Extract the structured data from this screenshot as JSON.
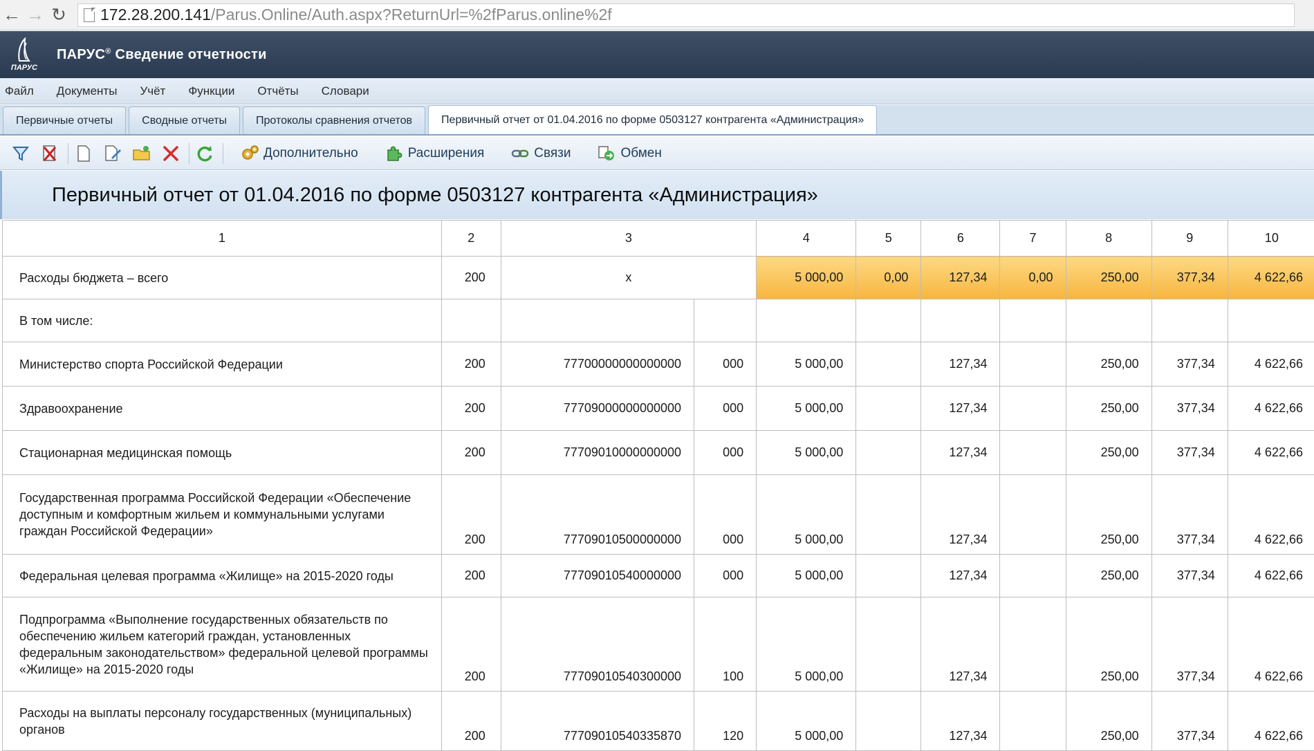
{
  "browser": {
    "url_host": "172.28.200.141",
    "url_path": "/Parus.Online/Auth.aspx?ReturnUrl=%2fParus.online%2f"
  },
  "app": {
    "logo_text": "ПАРУС",
    "title": "ПАРУС",
    "title_sup": "®",
    "title_rest": " Сведение отчетности"
  },
  "menu": [
    "Файл",
    "Документы",
    "Учёт",
    "Функции",
    "Отчёты",
    "Словари"
  ],
  "tabs": [
    {
      "label": "Первичные отчеты",
      "active": false
    },
    {
      "label": "Сводные отчеты",
      "active": false
    },
    {
      "label": "Протоколы сравнения отчетов",
      "active": false
    },
    {
      "label": "Первичный отчет от 01.04.2016 по форме 0503127 контрагента «Администрация»",
      "active": true
    }
  ],
  "toolbar": {
    "icons": [
      "filter-icon",
      "clear-filter-icon",
      "new-document-icon",
      "edit-document-icon",
      "open-folder-icon",
      "delete-icon",
      "refresh-icon"
    ],
    "buttons": [
      {
        "label": "Дополнительно",
        "icon": "gears-icon"
      },
      {
        "label": "Расширения",
        "icon": "puzzle-icon"
      },
      {
        "label": "Связи",
        "icon": "links-icon"
      },
      {
        "label": "Обмен",
        "icon": "exchange-icon"
      }
    ]
  },
  "report": {
    "caption": "Первичный отчет от 01.04.2016 по форме 0503127 контрагента «Администрация»",
    "columns": [
      "1",
      "2",
      "3",
      "4",
      "5",
      "6",
      "7",
      "8",
      "9",
      "10"
    ],
    "total_row": {
      "name": "Расходы бюджета – всего",
      "line": "200",
      "code": "x",
      "c4": "5 000,00",
      "c5": "0,00",
      "c6": "127,34",
      "c7": "0,00",
      "c8": "250,00",
      "c9": "377,34",
      "c10": "4 622,66"
    },
    "subheader": "В том числе:",
    "rows": [
      {
        "name": "Министерство спорта Российской Федерации",
        "line": "200",
        "code": "77700000000000000",
        "kvr": "000",
        "c4": "5 000,00",
        "c5": "",
        "c6": "127,34",
        "c7": "",
        "c8": "250,00",
        "c9": "377,34",
        "c10": "4 622,66"
      },
      {
        "name": "Здравоохранение",
        "line": "200",
        "code": "77709000000000000",
        "kvr": "000",
        "c4": "5 000,00",
        "c5": "",
        "c6": "127,34",
        "c7": "",
        "c8": "250,00",
        "c9": "377,34",
        "c10": "4 622,66"
      },
      {
        "name": "Стационарная медицинская помощь",
        "line": "200",
        "code": "77709010000000000",
        "kvr": "000",
        "c4": "5 000,00",
        "c5": "",
        "c6": "127,34",
        "c7": "",
        "c8": "250,00",
        "c9": "377,34",
        "c10": "4 622,66"
      },
      {
        "name": "Государственная программа Российской Федерации «Обеспечение доступным и комфортным жильем и коммунальными услугами граждан Российской Федерации»",
        "line": "200",
        "code": "77709010500000000",
        "kvr": "000",
        "c4": "5 000,00",
        "c5": "",
        "c6": "127,34",
        "c7": "",
        "c8": "250,00",
        "c9": "377,34",
        "c10": "4 622,66"
      },
      {
        "name": "Федеральная целевая программа «Жилище» на 2015-2020 годы",
        "line": "200",
        "code": "77709010540000000",
        "kvr": "000",
        "c4": "5 000,00",
        "c5": "",
        "c6": "127,34",
        "c7": "",
        "c8": "250,00",
        "c9": "377,34",
        "c10": "4 622,66"
      },
      {
        "name": "Подпрограмма «Выполнение государственных обязательств по обеспечению жильем категорий граждан, установленных федеральным законодательством» федеральной целевой программы «Жилище» на 2015-2020 годы",
        "line": "200",
        "code": "77709010540300000",
        "kvr": "100",
        "c4": "5 000,00",
        "c5": "",
        "c6": "127,34",
        "c7": "",
        "c8": "250,00",
        "c9": "377,34",
        "c10": "4 622,66"
      },
      {
        "name": "Расходы на выплаты персоналу государственных (муниципальных) органов",
        "line": "200",
        "code": "77709010540335870",
        "kvr": "120",
        "c4": "5 000,00",
        "c5": "",
        "c6": "127,34",
        "c7": "",
        "c8": "250,00",
        "c9": "377,34",
        "c10": "4 622,66"
      }
    ]
  }
}
